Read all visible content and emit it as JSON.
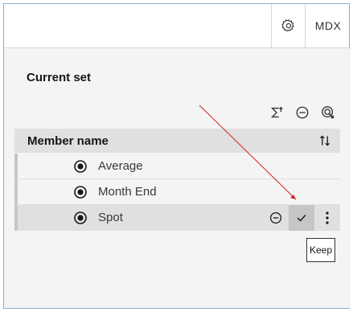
{
  "topbar": {
    "mdx_label": "MDX",
    "settings_icon": "gear-icon"
  },
  "panel": {
    "title": "Current set",
    "toolbar_icons": [
      "sum-icon",
      "remove-icon",
      "target-icon"
    ],
    "table": {
      "header": "Member name",
      "rows": [
        {
          "label": "Average"
        },
        {
          "label": "Month End"
        },
        {
          "label": "Spot",
          "selected": true
        }
      ]
    },
    "tooltip": "Keep"
  },
  "colors": {
    "accent": "#8faad6",
    "annotation_arrow": "#d62020"
  }
}
